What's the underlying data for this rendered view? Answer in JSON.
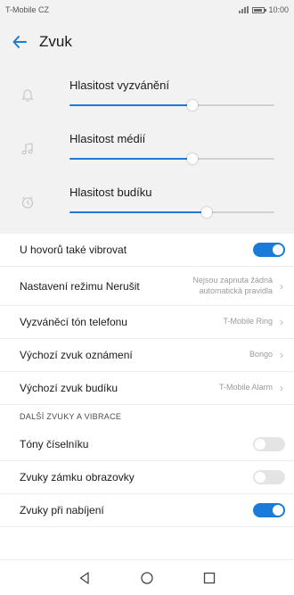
{
  "status_bar": {
    "carrier": "T-Mobile CZ",
    "time": "10:00"
  },
  "header": {
    "title": "Zvuk"
  },
  "volumes": [
    {
      "label": "Hlasitost vyzvánění",
      "icon": "bell-icon",
      "level": 0.6
    },
    {
      "label": "Hlasitost médií",
      "icon": "music-note-icon",
      "level": 0.6
    },
    {
      "label": "Hlasitost budíku",
      "icon": "alarm-clock-icon",
      "level": 0.67
    }
  ],
  "settings": {
    "vibrate_on_call": {
      "label": "U hovorů také vibrovat",
      "on": true
    },
    "dnd": {
      "label": "Nastavení režimu Nerušit",
      "value": "Nejsou zapnuta žádná automatická pravidla"
    },
    "ringtone": {
      "label": "Vyzváněcí tón telefonu",
      "value": "T-Mobile Ring"
    },
    "notification_sound": {
      "label": "Výchozí zvuk oznámení",
      "value": "Bongo"
    },
    "alarm_sound": {
      "label": "Výchozí zvuk budíku",
      "value": "T-Mobile Alarm"
    }
  },
  "section_more": {
    "title": "DALŠÍ ZVUKY A VIBRACE",
    "dial_tones": {
      "label": "Tóny číselníku",
      "on": false
    },
    "lock_sounds": {
      "label": "Zvuky zámku obrazovky",
      "on": false
    },
    "charging_sounds": {
      "label": "Zvuky při nabíjení",
      "on": true
    }
  },
  "colors": {
    "accent": "#1a7bd9",
    "panel": "#f2f2f2"
  }
}
